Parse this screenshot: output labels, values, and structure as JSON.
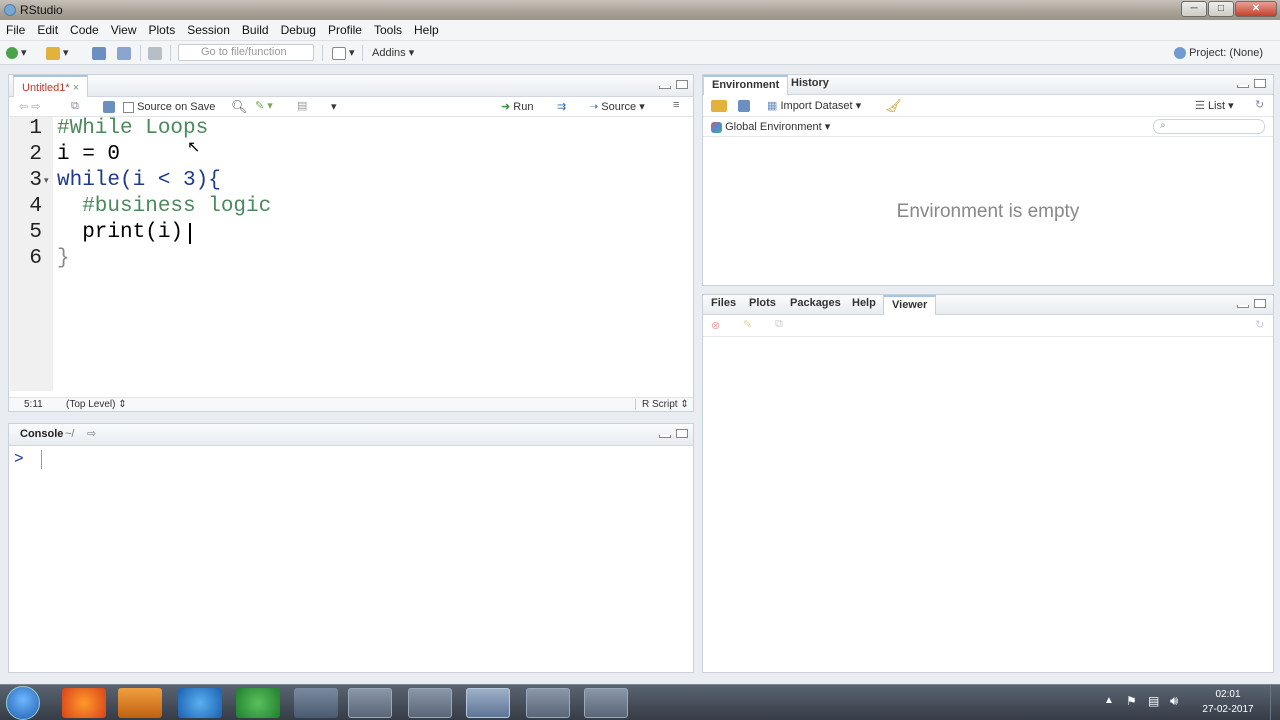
{
  "window": {
    "title": "RStudio",
    "min": "─",
    "max": "□",
    "close": "✕"
  },
  "menu": [
    "File",
    "Edit",
    "Code",
    "View",
    "Plots",
    "Session",
    "Build",
    "Debug",
    "Profile",
    "Tools",
    "Help"
  ],
  "toolbar": {
    "goto_placeholder": "Go to file/function",
    "addins": "Addins",
    "project": "Project: (None)"
  },
  "editor": {
    "tab_label": "Untitled1*",
    "source_on_save": "Source on Save",
    "run": "Run",
    "source": "Source",
    "lines": [
      {
        "n": "1",
        "text": "#While Loops"
      },
      {
        "n": "2",
        "text": "i = 0"
      },
      {
        "n": "3",
        "text": "while(i < 3){"
      },
      {
        "n": "4",
        "text": "  #business logic"
      },
      {
        "n": "5",
        "text": "  print(i)"
      },
      {
        "n": "6",
        "text": "}"
      }
    ],
    "status_pos": "5:11",
    "status_scope": "(Top Level)",
    "status_type": "R Script"
  },
  "console": {
    "title": "Console",
    "path": "~/",
    "prompt": ">"
  },
  "environment": {
    "tabs": [
      "Environment",
      "History"
    ],
    "import_dataset": "Import Dataset",
    "list": "List",
    "global_env": "Global Environment",
    "empty_message": "Environment is empty"
  },
  "files_pane": {
    "tabs": [
      "Files",
      "Plots",
      "Packages",
      "Help",
      "Viewer"
    ],
    "active": "Viewer"
  },
  "clock": {
    "time": "02:01",
    "date": "27-02-2017"
  },
  "colors": {
    "accent": "#1d3b8c",
    "comment": "#4a8a5c",
    "taskbar": "#353c46"
  }
}
